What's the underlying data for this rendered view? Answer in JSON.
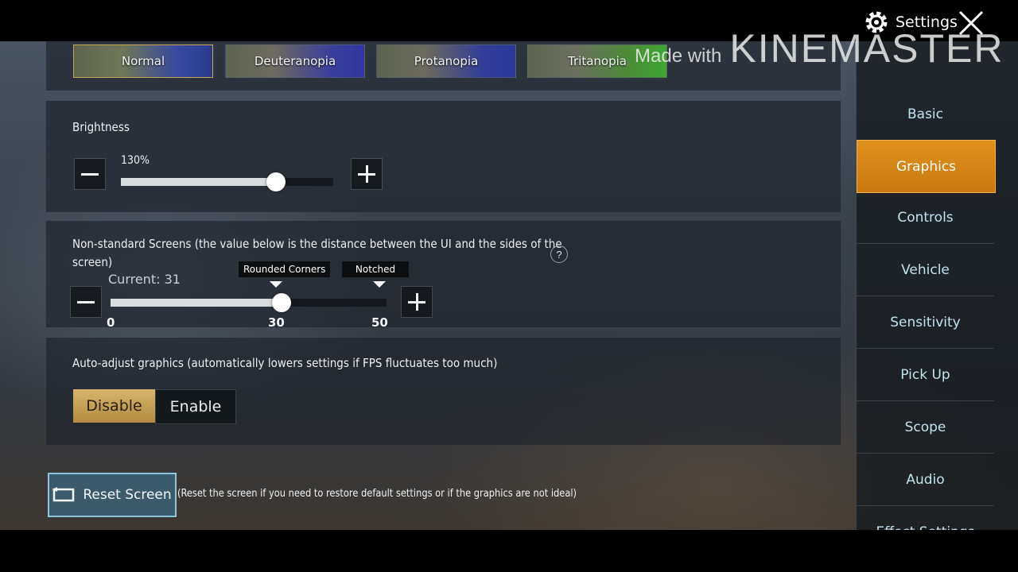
{
  "colorblind_filters": [
    "Normal",
    "Deuteranopia",
    "Protanopia",
    "Tritanopia"
  ],
  "brightness": {
    "title": "Brightness",
    "value_label": "130%",
    "slider_fraction": 0.73
  },
  "screens": {
    "title_line1": "Non-standard Screens (the value below is the distance between the UI and the sides of the",
    "title_line2": "screen)",
    "help": "?",
    "current": "Current: 31",
    "min": "0",
    "mid": "30",
    "max": "50",
    "value": 31,
    "tag_rounded": "Rounded Corners",
    "tag_notched": "Notched"
  },
  "auto_adjust": {
    "title": "Auto-adjust graphics (automatically lowers settings if FPS fluctuates too much)",
    "disable": "Disable",
    "enable": "Enable",
    "selected": "Disable"
  },
  "reset": {
    "label": "Reset Screen",
    "note": "(Reset the screen if you need to restore default settings or if the graphics are not ideal)"
  },
  "sidebar": {
    "title": "Settings",
    "items": [
      "Basic",
      "Graphics",
      "Controls",
      "Vehicle",
      "Sensitivity",
      "Pick Up",
      "Scope",
      "Audio",
      "Effect Settings"
    ],
    "active": "Graphics"
  },
  "watermark": {
    "small": "Made with",
    "big": "KINEMASTER"
  },
  "colors": {
    "accent_orange": "#e0921f",
    "selected_gold": "#d8b36a",
    "reset_border": "#8fc4dc",
    "sidebar_text": "#bfe3ee"
  },
  "icons": [
    "minus-icon",
    "plus-icon",
    "gear-icon",
    "close-icon",
    "reset-screen-icon",
    "help-icon"
  ]
}
